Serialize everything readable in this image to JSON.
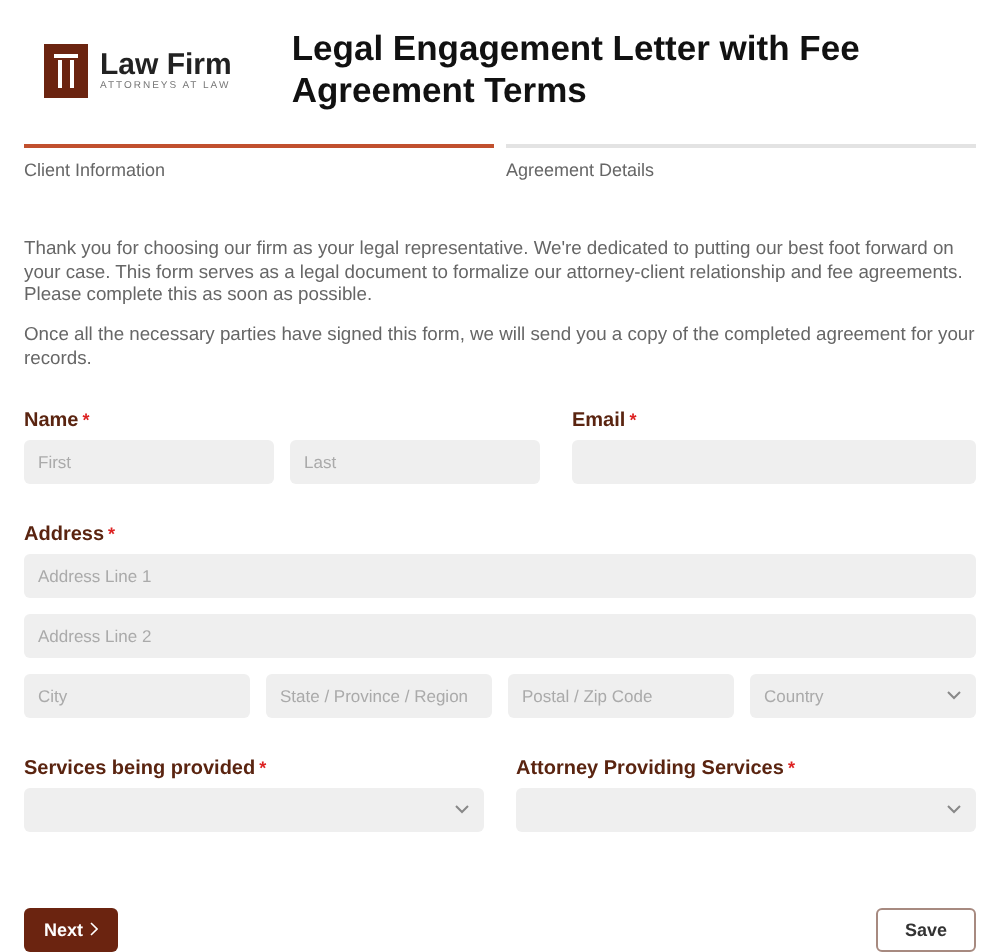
{
  "logo": {
    "name": "Law Firm",
    "tagline": "ATTORNEYS AT LAW"
  },
  "title": "Legal Engagement Letter with Fee Agreement Terms",
  "steps": [
    {
      "label": "Client Information",
      "selected": true
    },
    {
      "label": "Agreement Details",
      "selected": false
    }
  ],
  "intro": [
    "Thank you for choosing our firm as your legal representative. We're dedicated to putting our best foot forward on your case. This form serves as a legal document to formalize our attorney-client relationship and fee agreements. Please complete this as soon as possible.",
    "Once all the necessary parties have signed this form, we will send you a copy of the completed agreement for your records."
  ],
  "rows": [
    {
      "groups": [
        {
          "label": "Name",
          "required_mark": "*",
          "inputs": [
            {
              "kind": "text",
              "placeholder": "First"
            },
            {
              "kind": "text",
              "placeholder": "Last"
            }
          ]
        },
        {
          "label": "Email",
          "required_mark": "*",
          "inputs": [
            {
              "kind": "text"
            }
          ]
        }
      ]
    },
    {
      "groups": [
        {
          "label": "Address",
          "required_mark": "*",
          "lines": [
            [
              {
                "kind": "text",
                "placeholder": "Address Line 1"
              }
            ],
            [
              {
                "kind": "text",
                "placeholder": "Address Line 2"
              }
            ],
            [
              {
                "kind": "text",
                "placeholder": "City"
              },
              {
                "kind": "text",
                "placeholder": "State / Province / Region"
              },
              {
                "kind": "text",
                "placeholder": "Postal / Zip Code"
              },
              {
                "kind": "select",
                "placeholder": "Country"
              }
            ]
          ]
        }
      ]
    },
    {
      "groups": [
        {
          "label": "Services being provided",
          "required_mark": "*",
          "inputs": [
            {
              "kind": "select"
            }
          ]
        },
        {
          "label": "Attorney Providing Services",
          "required_mark": "*",
          "inputs": [
            {
              "kind": "select"
            }
          ]
        }
      ]
    }
  ],
  "buttons": {
    "next": "Next",
    "save": "Save"
  }
}
